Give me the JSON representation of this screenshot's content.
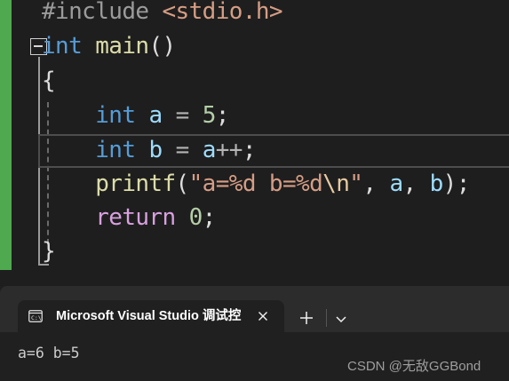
{
  "editor": {
    "lines": [
      [
        [
          "tk-pre",
          "#include "
        ],
        [
          "tk-inc",
          "<stdio.h>"
        ]
      ],
      [
        [
          "tk-kw",
          "int"
        ],
        [
          "tk-pun",
          " "
        ],
        [
          "tk-fn",
          "main"
        ],
        [
          "tk-pun",
          "()"
        ]
      ],
      [
        [
          "tk-pun",
          "{"
        ]
      ],
      [
        [
          "tk-pun",
          "    "
        ],
        [
          "tk-kw",
          "int"
        ],
        [
          "tk-pun",
          " "
        ],
        [
          "tk-var",
          "a"
        ],
        [
          "tk-op",
          " = "
        ],
        [
          "tk-num",
          "5"
        ],
        [
          "tk-pun",
          ";"
        ]
      ],
      [
        [
          "tk-pun",
          "    "
        ],
        [
          "tk-kw",
          "int"
        ],
        [
          "tk-pun",
          " "
        ],
        [
          "tk-var",
          "b"
        ],
        [
          "tk-op",
          " = "
        ],
        [
          "tk-var",
          "a"
        ],
        [
          "tk-op",
          "++"
        ],
        [
          "tk-pun",
          ";"
        ]
      ],
      [
        [
          "tk-pun",
          "    "
        ],
        [
          "tk-fn",
          "printf"
        ],
        [
          "tk-pun",
          "("
        ],
        [
          "tk-str",
          "\"a=%d b=%d"
        ],
        [
          "tk-esc",
          "\\n"
        ],
        [
          "tk-str",
          "\""
        ],
        [
          "tk-pun",
          ", "
        ],
        [
          "tk-var",
          "a"
        ],
        [
          "tk-pun",
          ", "
        ],
        [
          "tk-var",
          "b"
        ],
        [
          "tk-pun",
          ");"
        ]
      ],
      [
        [
          "tk-pun",
          "    "
        ],
        [
          "tk-ret",
          "return"
        ],
        [
          "tk-pun",
          " "
        ],
        [
          "tk-num",
          "0"
        ],
        [
          "tk-pun",
          ";"
        ]
      ],
      [
        [
          "tk-pun",
          "}"
        ]
      ]
    ],
    "colors": {
      "change_bar": "#4faa4f",
      "keyword": "#569cd6",
      "function": "#dcdcaa",
      "variable": "#9cdcfe",
      "number": "#b5cea8",
      "string": "#d69d85",
      "control": "#d8a0df"
    }
  },
  "terminal": {
    "tab_icon": "console-icon",
    "tab_title": "Microsoft Visual Studio 调试控",
    "close_icon": "close-icon",
    "new_tab_icon": "plus-icon",
    "dropdown_icon": "chevron-down-icon",
    "output": "a=6 b=5"
  },
  "watermark": "CSDN @无敌GGBond"
}
